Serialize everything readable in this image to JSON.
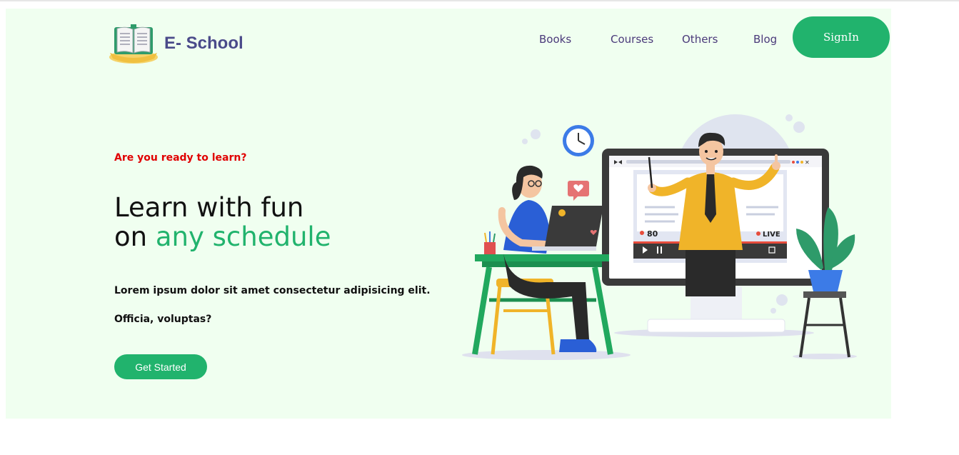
{
  "brand": {
    "name": "E- School",
    "logo_icon": "book-icon"
  },
  "nav": {
    "items": [
      {
        "label": "Books"
      },
      {
        "label": "Courses"
      },
      {
        "label": "Others"
      },
      {
        "label": "Blog"
      }
    ],
    "signin_label": "SignIn"
  },
  "hero": {
    "tagline": "Are you ready to learn?",
    "headline_line1": "Learn with fun",
    "headline_line2_prefix": "on ",
    "headline_line2_accent": "any schedule",
    "description_line1": "Lorem ipsum dolor sit amet consectetur adipisicing elit.",
    "description_line2": "Officia, voluptas?",
    "cta_label": "Get Started"
  },
  "illustration": {
    "viewer_count": "80",
    "live_label": "LIVE"
  },
  "colors": {
    "accent": "#21b36d",
    "hero_bg": "#f0fff0",
    "tagline": "#e00000",
    "brand_text": "#4a4a8a"
  }
}
